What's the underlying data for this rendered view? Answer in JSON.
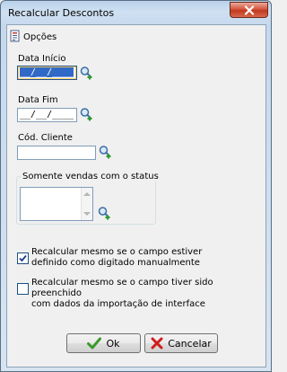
{
  "window": {
    "title": "Recalcular Descontos"
  },
  "section": {
    "label": "Opções"
  },
  "fields": {
    "data_inicio": {
      "label": "Data Início",
      "value": "__/__/____"
    },
    "data_fim": {
      "label": "Data Fim",
      "value": "__/__/____"
    },
    "cod_cliente": {
      "label": "Cód. Cliente",
      "value": ""
    }
  },
  "status_group": {
    "title": "Somente vendas com o status"
  },
  "checkboxes": [
    {
      "line1": "Recalcular mesmo se o campo estiver",
      "line2": "definido como digitado manualmente",
      "checked": true
    },
    {
      "line1": "Recalcular mesmo se o campo tiver sido preenchido",
      "line2": "com dados da importação de interface",
      "checked": false
    }
  ],
  "buttons": {
    "ok": "Ok",
    "cancel": "Cancelar"
  },
  "colors": {
    "accent_selection": "#3169c6",
    "ok_green": "#3a9a2a",
    "cancel_red": "#d01c1c"
  }
}
